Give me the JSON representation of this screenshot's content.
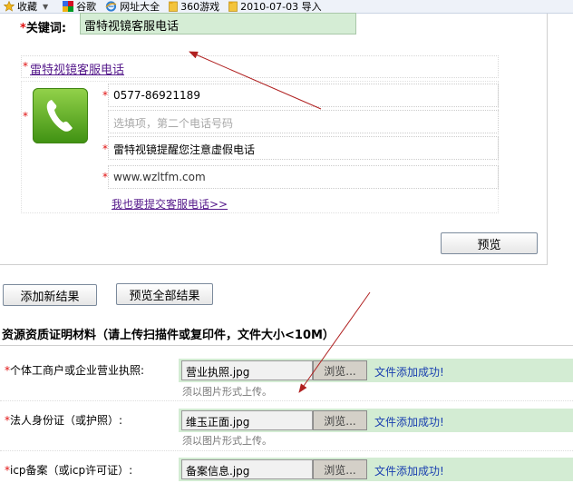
{
  "favorites": [
    {
      "label": "收藏",
      "icon": "star-icon",
      "has_dropdown": true
    },
    {
      "label": "谷歌",
      "icon": "google-icon"
    },
    {
      "label": "网址大全",
      "icon": "ie-icon"
    },
    {
      "label": "360游戏",
      "icon": "folder-icon"
    },
    {
      "label": "2010-07-03 导入",
      "icon": "folder-icon"
    }
  ],
  "form": {
    "required_mark": "*",
    "keyword_label": "关键词:",
    "keyword_value": "雷特视镜客服电话",
    "result_title": "雷特视镜客服电话",
    "phone": "0577-86921189",
    "phone2_placeholder": "选填项，第二个电话号码",
    "description": "雷特视镜提醒您注意虚假电话",
    "website": "www.wzltfm.com",
    "submit_link": "我也要提交客服电话>>",
    "preview_button": "预览"
  },
  "actions": {
    "add_result": "添加新结果",
    "preview_all": "预览全部结果"
  },
  "credentials": {
    "title": "资源资质证明材料（请上传扫描件或复印件，文件大小<10M）",
    "browse_label": "浏览...",
    "success_text": "文件添加成功!",
    "hint": "须以图片形式上传。",
    "rows": [
      {
        "label": "个体工商户或企业营业执照:",
        "file": "营业执照.jpg"
      },
      {
        "label": "法人身份证（或护照）:",
        "file": "维玉正面.jpg"
      },
      {
        "label": "icp备案（或icp许可证）:",
        "file": "备案信息.jpg"
      }
    ]
  },
  "colors": {
    "annotation_arrow": "#b02020",
    "field_green": "#d3ecd3",
    "link_purple": "#55198b",
    "success_blue": "#1a3fb0"
  }
}
